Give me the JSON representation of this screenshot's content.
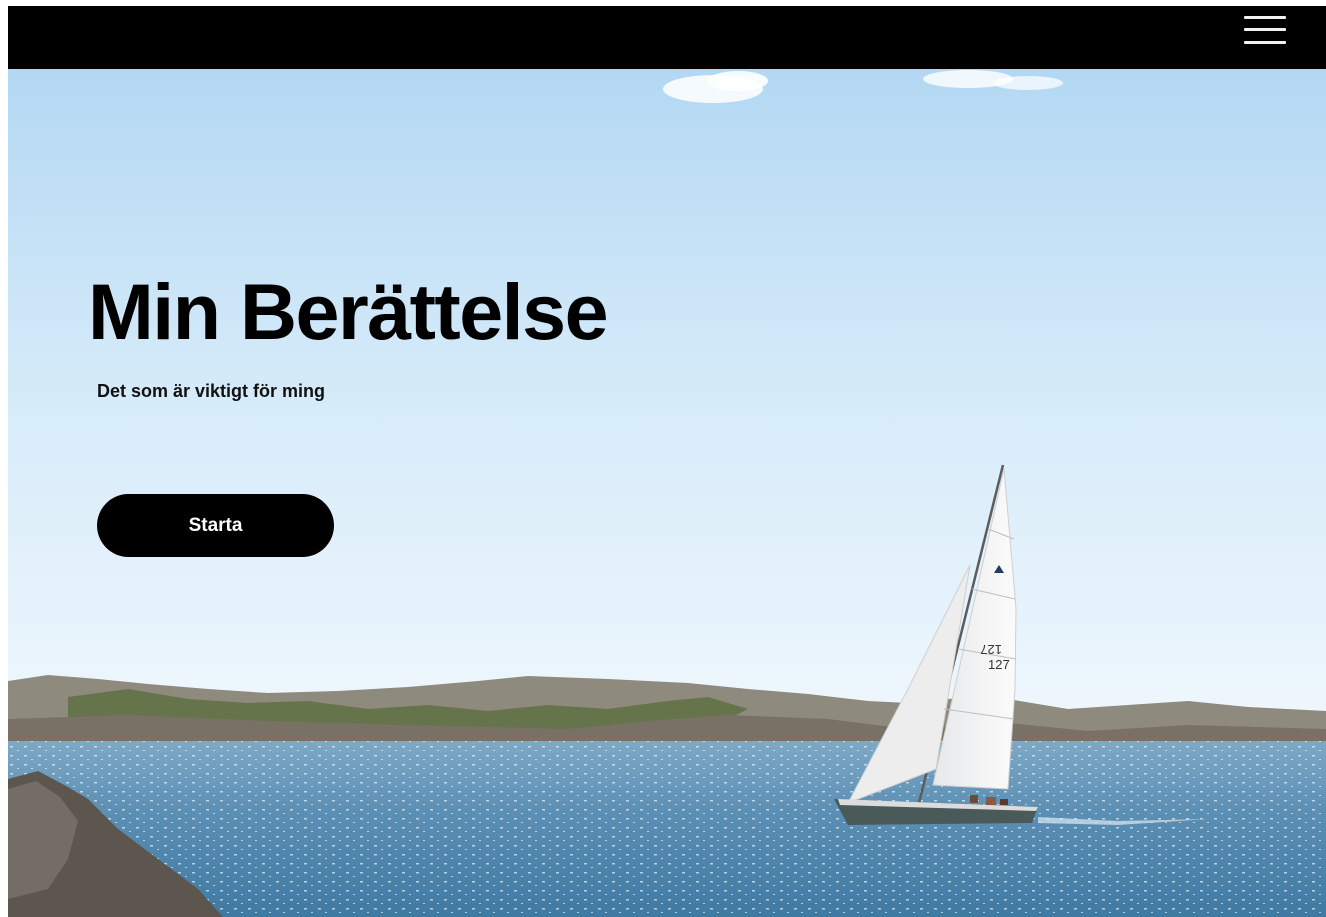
{
  "header": {
    "menu_icon": "hamburger-menu-icon"
  },
  "hero": {
    "title": "Min Berättelse",
    "subtitle": "Det som är viktigt för ming",
    "start_button_label": "Starta",
    "background_image": "sailboat-archipelago-photo",
    "sail_numbers": [
      "127",
      "127"
    ]
  },
  "colors": {
    "topbar": "#000000",
    "button_bg": "#000000",
    "button_text": "#ffffff",
    "title_text": "#000000",
    "sky_top": "#b7dbf4",
    "sky_bottom": "#eef7fd",
    "water": "#5a8fb3"
  }
}
